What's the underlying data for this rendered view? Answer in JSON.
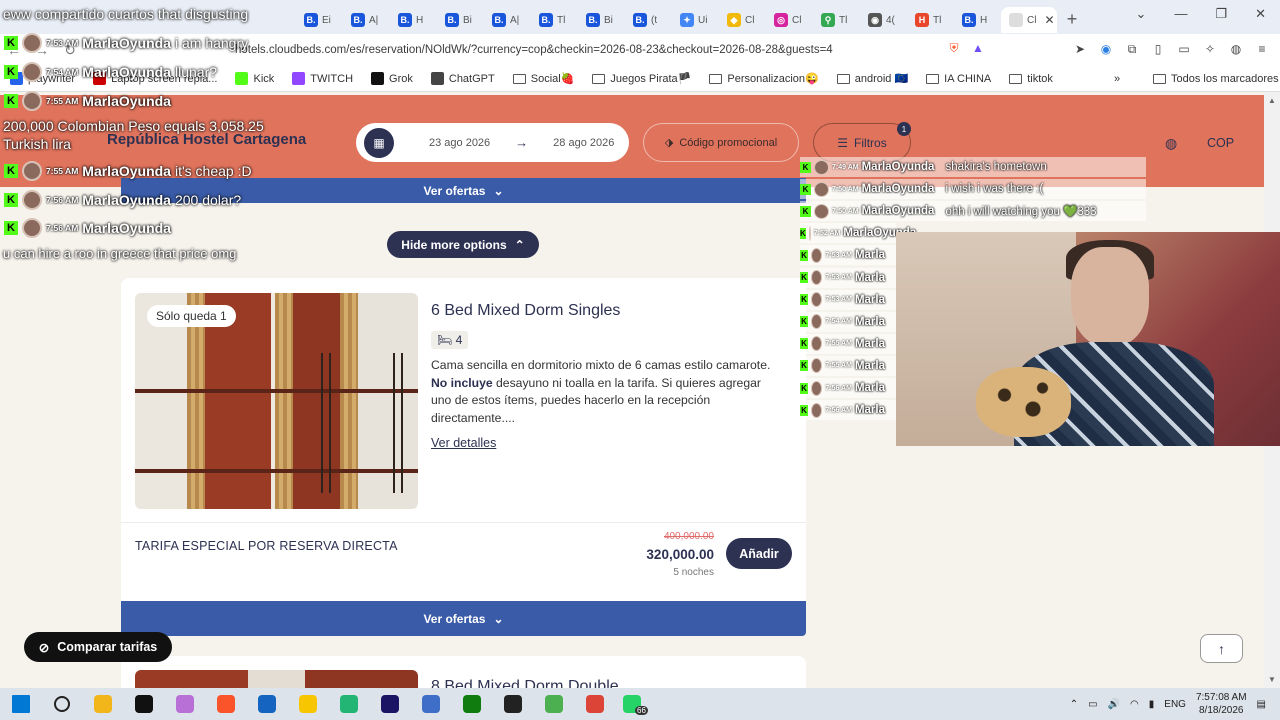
{
  "browser": {
    "tabs": [
      {
        "label": "Ei",
        "fav_color": "#1a56db",
        "fav_text": "B."
      },
      {
        "label": "A|",
        "fav_color": "#1a56db",
        "fav_text": "B."
      },
      {
        "label": "H",
        "fav_color": "#1a56db",
        "fav_text": "B."
      },
      {
        "label": "Bi",
        "fav_color": "#1a56db",
        "fav_text": "B."
      },
      {
        "label": "A|",
        "fav_color": "#1a56db",
        "fav_text": "B."
      },
      {
        "label": "Tl",
        "fav_color": "#1a56db",
        "fav_text": "B."
      },
      {
        "label": "Bi",
        "fav_color": "#1a56db",
        "fav_text": "B."
      },
      {
        "label": "(t",
        "fav_color": "#1a56db",
        "fav_text": "B."
      },
      {
        "label": "Ui",
        "fav_color": "#4285f4",
        "fav_text": "✦"
      },
      {
        "label": "Cl",
        "fav_color": "#f0b90b",
        "fav_text": "◆"
      },
      {
        "label": "Cl",
        "fav_color": "#d6249f",
        "fav_text": "◎"
      },
      {
        "label": "Tl",
        "fav_color": "#34a853",
        "fav_text": "⚲"
      },
      {
        "label": "4(",
        "fav_color": "#555555",
        "fav_text": "◉"
      },
      {
        "label": "Tl",
        "fav_color": "#e8472b",
        "fav_text": "H"
      },
      {
        "label": "H",
        "fav_color": "#1a56db",
        "fav_text": "B."
      }
    ],
    "active_tab": {
      "label": "Cl",
      "close": "✕"
    },
    "new_tab": "+",
    "window_controls": [
      "⌄",
      "—",
      "❐",
      "✕"
    ],
    "url": "hotels.cloudbeds.com/es/reservation/NOldWk/?currency=cop&checkin=2026-08-23&checkout=2026-08-28&guests=4",
    "bookmarks": [
      {
        "label": "playwriter",
        "kind": "icon",
        "color": "#2563eb"
      },
      {
        "label": "Laptop screen repla...",
        "kind": "icon",
        "color": "#cc0000"
      },
      {
        "label": "Kick",
        "kind": "icon",
        "color": "#53fc18"
      },
      {
        "label": "TWITCH",
        "kind": "icon",
        "color": "#9146ff"
      },
      {
        "label": "Grok",
        "kind": "icon",
        "color": "#111111"
      },
      {
        "label": "ChatGPT",
        "kind": "icon",
        "color": "#444444"
      },
      {
        "label": "Social🍓",
        "kind": "folder"
      },
      {
        "label": "Juegos Pirata🏴",
        "kind": "folder"
      },
      {
        "label": "Personalizacion😜",
        "kind": "folder"
      },
      {
        "label": "android 🇪🇺",
        "kind": "folder"
      },
      {
        "label": "IA CHINA",
        "kind": "folder"
      },
      {
        "label": "tiktok",
        "kind": "folder"
      }
    ],
    "bookmarks_more": "»",
    "all_bookmarks": "Todos los marcadores"
  },
  "header": {
    "hostel_name": "República Hostel Cartagena",
    "checkin": "23 ago 2026",
    "checkout": "28 ago 2026",
    "arrow": "→",
    "promo_label": "Código promocional",
    "filters_label": "Filtros",
    "filters_count": "1",
    "currency": "COP"
  },
  "offers_top": {
    "label": "Ver ofertas"
  },
  "hide_more": {
    "label": "Hide more options"
  },
  "room": {
    "badge": "Sólo queda 1",
    "title": "6 Bed Mixed Dorm Singles",
    "beds": "4",
    "description_1": "Cama sencilla en dormitorio mixto de 6 camas estilo camarote. ",
    "description_bold": "No incluye",
    "description_2": " desayuno ni toalla en la tarifa. Si quieres agregar uno de estos ítems, puedes hacerlo en la recepción directamente....",
    "details_link": "Ver detalles",
    "rate_name": "TARIFA ESPECIAL POR RESERVA DIRECTA",
    "old_price": "400,000.00",
    "price": "320,000.00",
    "nights": "5 noches",
    "add_label": "Añadir"
  },
  "offers_bottom": {
    "label": "Ver ofertas"
  },
  "next_room_title": "8 Bed Mixed Dorm Double",
  "compare": {
    "label": "Comparar tarifas"
  },
  "overlay_left": {
    "title_line": "eww compartido cuartos that disgusting",
    "messages": [
      {
        "time": "7:53 AM",
        "user": "MarlaOyunda",
        "msg": "i am hangry"
      },
      {
        "time": "7:54 AM",
        "user": "MarlaOyunda",
        "msg": "llunar?"
      },
      {
        "time": "7:55 AM",
        "user": "MarlaOyunda",
        "msg": ""
      },
      {
        "time": "7:55 AM",
        "user": "MarlaOyunda",
        "msg": "it's cheap :D"
      },
      {
        "time": "7:56 AM",
        "user": "MarlaOyunda",
        "msg": "200 dolar?"
      },
      {
        "time": "7:56 AM",
        "user": "MarlaOyunda",
        "msg": ""
      }
    ],
    "conversion_line_1": "200,000 Colombian Peso equals 3,058.25",
    "conversion_line_2": "Turkish lira",
    "footer_line": "u can hire a roo in greece that price omg"
  },
  "overlay_right": {
    "messages": [
      {
        "time": "7:49 AM",
        "user": "MarlaOyunda",
        "msg": "shakira's hometown"
      },
      {
        "time": "7:50 AM",
        "user": "MarlaOyunda",
        "msg": "i wish i was there :("
      },
      {
        "time": "7:50 AM",
        "user": "MarlaOyunda",
        "msg": "ohh i will watching you 💚333"
      },
      {
        "time": "7:52 AM",
        "user": "MarlaOyunda",
        "msg": ""
      },
      {
        "time": "7:53 AM",
        "user": "Marla",
        "msg": ""
      },
      {
        "time": "7:53 AM",
        "user": "Marla",
        "msg": ""
      },
      {
        "time": "7:53 AM",
        "user": "Marla",
        "msg": ""
      },
      {
        "time": "7:54 AM",
        "user": "Marla",
        "msg": ""
      },
      {
        "time": "7:55 AM",
        "user": "Marla",
        "msg": ""
      },
      {
        "time": "7:55 AM",
        "user": "Marla",
        "msg": ""
      },
      {
        "time": "7:56 AM",
        "user": "Marla",
        "msg": ""
      },
      {
        "time": "7:56 AM",
        "user": "Marla",
        "msg": ""
      }
    ]
  },
  "taskbar": {
    "apps": [
      {
        "name": "windows",
        "color": "#0078d4"
      },
      {
        "name": "search",
        "color": "#222222"
      },
      {
        "name": "file-explorer",
        "color": "#f2b61b"
      },
      {
        "name": "notion",
        "color": "#111111"
      },
      {
        "name": "app",
        "color": "#b86fd6"
      },
      {
        "name": "brave",
        "color": "#fb542b"
      },
      {
        "name": "store",
        "color": "#1565c0"
      },
      {
        "name": "sticky",
        "color": "#f7c600"
      },
      {
        "name": "ccleaner",
        "color": "#22b573"
      },
      {
        "name": "studio",
        "color": "#1b1464"
      },
      {
        "name": "app2",
        "color": "#3f6ec9"
      },
      {
        "name": "xbox",
        "color": "#107c10"
      },
      {
        "name": "obs",
        "color": "#222222"
      },
      {
        "name": "app3",
        "color": "#4caf50"
      },
      {
        "name": "chrome",
        "color": "#db4437"
      },
      {
        "name": "whatsapp",
        "color": "#25d366"
      }
    ],
    "whatsapp_badge": "66",
    "language": "ENG",
    "time": "7:57:08 AM",
    "date": "8/18/2026"
  }
}
